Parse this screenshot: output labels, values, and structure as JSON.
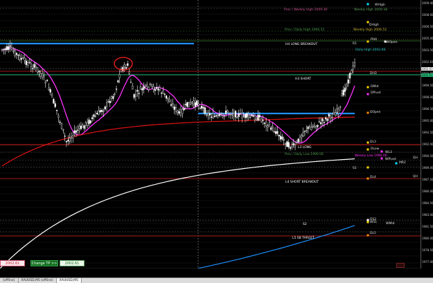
{
  "window": {
    "symbol": "XAUUSD,M5",
    "status": "(offline)"
  },
  "level_labels": {
    "prev_weekly_high": "Prev / Weekly High 2009.38",
    "weekly_high": "Weekly High 2009.38",
    "wHigh": "WHigh",
    "dHigh": "DHigh",
    "prev_daily_high": "Prev / Daily High 2006.52",
    "weekly_high_2": "Weekly High 2006.52",
    "h4_long_breakout": "H4 LONG BREAKOUT",
    "r1": "R1",
    "wopen": "WOpen",
    "ph4": "PH4",
    "daily_high": "Daily High 2002.68",
    "dh3": "DH3",
    "h3_short": "H3 SHORT",
    "dmid": "DMid",
    "dpivot": "DPivot",
    "dopen": "DOpen",
    "dl3": "DL3",
    "l3_long": "L3 LONG",
    "dlow": "DLow",
    "wl3": "WL3",
    "weekly_low": "Weekly Low 1990.06",
    "prev_daily_low": "Prev / Daily Low 1990.06",
    "wpivot": "WPivot",
    "mr2": "MR2",
    "qh": "QH",
    "s1": "S1",
    "dl4": "DL4",
    "qhh": "QH",
    "l4_short_breakout": "L4 SHORT BREAKOUT",
    "ds2": "DS2",
    "wmid": "WMid",
    "ws1": "WS1",
    "s2": "S2",
    "dl5": "DL5",
    "l5_sb_target": "L5 SB TARGET"
  },
  "price_axis": {
    "ticks": [
      "2009.40",
      "2008.00",
      "2006.50",
      "2005.00",
      "2003.50",
      "2002.61",
      "2001.00",
      "1999.50",
      "1998.00",
      "1996.50",
      "1995.00",
      "1993.50",
      "1992.00",
      "1990.50",
      "1989.00",
      "1987.50",
      "1986.00",
      "1984.50",
      "1983.00",
      "1981.50",
      "1980.00",
      "1978.50",
      "1977.00"
    ],
    "current_price": "2002.61"
  },
  "time_axis": {
    "ticks": [
      "30 Oct 2023",
      "30 Oct 04:30",
      "30 Oct 06:30",
      "30 Oct 08:30",
      "30 Oct 10:30",
      "30 Oct 12:30",
      "30 Oct 14:30",
      "30 Oct 16:30",
      "30 Oct 18:30",
      "30 Oct 20:30",
      "30 Oct 22:30",
      "31 Oct 01:30",
      "31 Oct 03:30",
      "31 Oct 05:30",
      "31 Oct 07:30",
      "31 Oct 09:30",
      "31 Oct 11:30",
      "31 Oct 13:30",
      "31 Oct 15:30"
    ]
  },
  "bottom_widgets": {
    "bid": "2002.61",
    "change_tp_button": "Change TP >>",
    "ask": "2002.61"
  },
  "tabs": [
    "(offline)",
    "XAUUSD,M5 (offline)",
    "XAUUSD,M5"
  ],
  "colors": {
    "background": "#000000",
    "bull_candle": "#ffffff",
    "bear_candle": "#ffffff",
    "ma_fast": "#ff33ff",
    "ma_slow": "#e01010",
    "ma_long_white": "#ffffff",
    "ma_long_blue": "#1e90ff",
    "breakout_blue": "#1e90ff",
    "red_level": "#d01a1a",
    "green_level": "#2ecc71",
    "annotation_circle": "#ff2020"
  }
}
